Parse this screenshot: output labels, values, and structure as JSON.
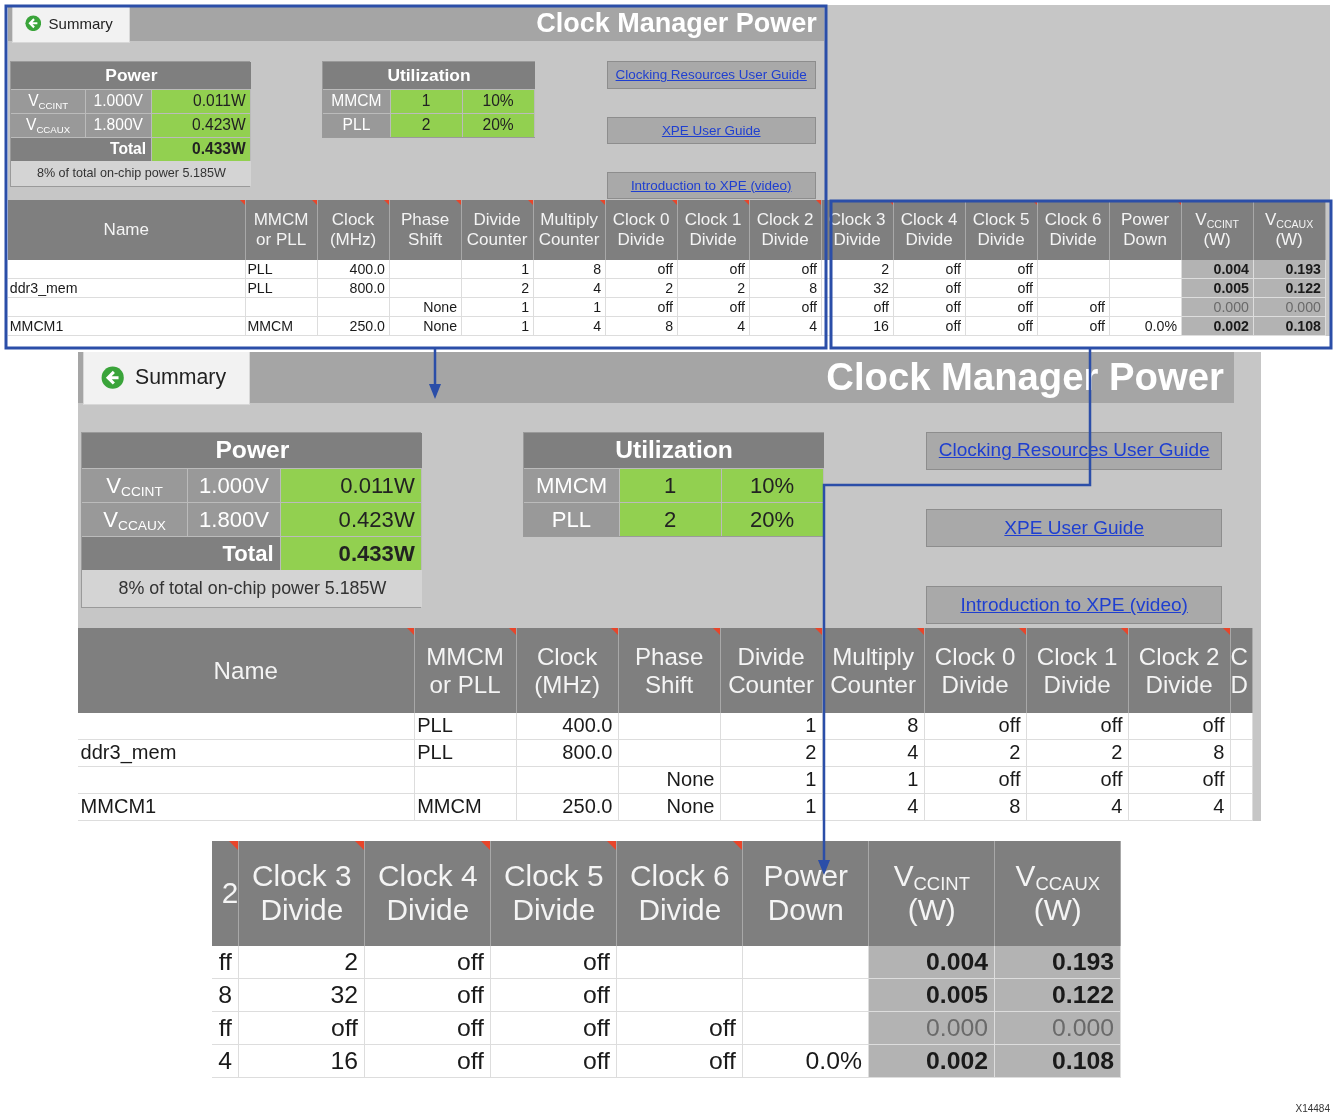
{
  "overview": {
    "summary_button": "Summary",
    "title": "Clock Manager Power",
    "power": {
      "heading": "Power",
      "rows": [
        {
          "label": "V$_{CCINT}$",
          "voltage": "1.000V",
          "watts": "0.011W"
        },
        {
          "label": "V$_{CCAUX}$",
          "voltage": "1.800V",
          "watts": "0.423W"
        }
      ],
      "total_label": "Total",
      "total": "0.433W",
      "note": "8% of total on-chip power 5.185W"
    },
    "utilization": {
      "heading": "Utilization",
      "rows": [
        {
          "label": "MMCM",
          "count": "1",
          "percent": "10%"
        },
        {
          "label": "PLL",
          "count": "2",
          "percent": "20%"
        }
      ]
    },
    "links": [
      "Clocking Resources User Guide",
      "XPE User Guide",
      "Introduction to XPE (video)"
    ],
    "table": {
      "columns": [
        {
          "kind": "name",
          "header": [
            "Name"
          ],
          "note": true
        },
        {
          "kind": "text",
          "header": [
            "MMCM",
            "or PLL"
          ],
          "note": true
        },
        {
          "kind": "number",
          "header": [
            "Clock",
            "(MHz)"
          ],
          "note": true
        },
        {
          "kind": "number",
          "header": [
            "Phase",
            "Shift"
          ],
          "note": true
        },
        {
          "kind": "number",
          "header": [
            "Divide",
            "Counter"
          ],
          "note": true
        },
        {
          "kind": "number",
          "header": [
            "Multiply",
            "Counter"
          ],
          "note": true
        },
        {
          "kind": "number",
          "header": [
            "Clock 0",
            "Divide"
          ],
          "note": true
        },
        {
          "kind": "number",
          "header": [
            "Clock 1",
            "Divide"
          ],
          "note": true
        },
        {
          "kind": "number",
          "header": [
            "Clock 2",
            "Divide"
          ],
          "note": true
        },
        {
          "kind": "number",
          "header": [
            "Clock 3",
            "Divide"
          ],
          "note": true
        },
        {
          "kind": "number",
          "header": [
            "Clock 4",
            "Divide"
          ],
          "note": false
        },
        {
          "kind": "number",
          "header": [
            "Clock 5",
            "Divide"
          ],
          "note": true
        },
        {
          "kind": "number",
          "header": [
            "Clock 6",
            "Divide"
          ],
          "note": false
        },
        {
          "kind": "number",
          "header": [
            "Power",
            "Down"
          ],
          "note": true
        },
        {
          "kind": "power",
          "header": [
            "V$_{CCINT}$",
            "(W)"
          ],
          "note": false
        },
        {
          "kind": "power",
          "header": [
            "V$_{CCAUX}$",
            "(W)"
          ],
          "note": false
        }
      ],
      "rows": [
        {
          "dimmed": false,
          "cells": [
            "",
            "PLL",
            "400.0",
            "",
            "1",
            "8",
            "off",
            "off",
            "off",
            "2",
            "off",
            "off",
            "",
            "",
            "0.004",
            "0.193"
          ]
        },
        {
          "dimmed": false,
          "cells": [
            "ddr3_mem",
            "PLL",
            "800.0",
            "",
            "2",
            "4",
            "2",
            "2",
            "8",
            "32",
            "off",
            "off",
            "",
            "",
            "0.005",
            "0.122"
          ]
        },
        {
          "dimmed": true,
          "cells": [
            "",
            "",
            "",
            "None",
            "1",
            "1",
            "off",
            "off",
            "off",
            "off",
            "off",
            "off",
            "off",
            "",
            "0.000",
            "0.000"
          ]
        },
        {
          "dimmed": false,
          "cells": [
            "MMCM1",
            "MMCM",
            "250.0",
            "None",
            "1",
            "4",
            "8",
            "4",
            "4",
            "16",
            "off",
            "off",
            "off",
            "0.0%",
            "0.002",
            "0.108"
          ]
        }
      ]
    }
  },
  "detail_left": {
    "summary_button": "Summary",
    "title": "Clock Manager Power",
    "power": {
      "heading": "Power",
      "rows": [
        {
          "label": "V$_{CCINT}$",
          "voltage": "1.000V",
          "watts": "0.011W"
        },
        {
          "label": "V$_{CCAUX}$",
          "voltage": "1.800V",
          "watts": "0.423W"
        }
      ],
      "total_label": "Total",
      "total": "0.433W",
      "note": "8% of total on-chip power 5.185W"
    },
    "utilization": {
      "heading": "Utilization",
      "rows": [
        {
          "label": "MMCM",
          "count": "1",
          "percent": "10%"
        },
        {
          "label": "PLL",
          "count": "2",
          "percent": "20%"
        }
      ]
    },
    "links": [
      "Clocking Resources User Guide",
      "XPE User Guide",
      "Introduction to XPE (video)"
    ],
    "table": {
      "columns": [
        {
          "kind": "name",
          "header": [
            "Name"
          ],
          "note": true
        },
        {
          "kind": "text",
          "header": [
            "MMCM",
            "or PLL"
          ],
          "note": true
        },
        {
          "kind": "number",
          "header": [
            "Clock",
            "(MHz)"
          ],
          "note": true
        },
        {
          "kind": "number",
          "header": [
            "Phase",
            "Shift"
          ],
          "note": true
        },
        {
          "kind": "number",
          "header": [
            "Divide",
            "Counter"
          ],
          "note": true
        },
        {
          "kind": "number",
          "header": [
            "Multiply",
            "Counter"
          ],
          "note": true
        },
        {
          "kind": "number",
          "header": [
            "Clock 0",
            "Divide"
          ],
          "note": true
        },
        {
          "kind": "number",
          "header": [
            "Clock 1",
            "Divide"
          ],
          "note": true
        },
        {
          "kind": "number",
          "header": [
            "Clock 2",
            "Divide"
          ],
          "note": true
        },
        {
          "kind": "cut_end",
          "header": [
            "C",
            "D"
          ],
          "note": false
        }
      ],
      "rows": [
        {
          "cells": [
            "",
            "PLL",
            "400.0",
            "",
            "1",
            "8",
            "off",
            "off",
            "off",
            ""
          ]
        },
        {
          "cells": [
            "ddr3_mem",
            "PLL",
            "800.0",
            "",
            "2",
            "4",
            "2",
            "2",
            "8",
            ""
          ]
        },
        {
          "cells": [
            "",
            "",
            "",
            "None",
            "1",
            "1",
            "off",
            "off",
            "off",
            ""
          ]
        },
        {
          "cells": [
            "MMCM1",
            "MMCM",
            "250.0",
            "None",
            "1",
            "4",
            "8",
            "4",
            "4",
            ""
          ]
        }
      ]
    }
  },
  "detail_right": {
    "table": {
      "columns": [
        {
          "kind": "cut_start",
          "header": [
            "2"
          ],
          "note": true
        },
        {
          "kind": "number",
          "header": [
            "Clock 3",
            "Divide"
          ],
          "note": true
        },
        {
          "kind": "number",
          "header": [
            "Clock 4",
            "Divide"
          ],
          "note": true
        },
        {
          "kind": "number",
          "header": [
            "Clock 5",
            "Divide"
          ],
          "note": true
        },
        {
          "kind": "number",
          "header": [
            "Clock 6",
            "Divide"
          ],
          "note": true
        },
        {
          "kind": "number",
          "header": [
            "Power",
            "Down"
          ],
          "note": false
        },
        {
          "kind": "power",
          "header": [
            "V$_{CCINT}$",
            "(W)"
          ],
          "note": false
        },
        {
          "kind": "power",
          "header": [
            "V$_{CCAUX}$",
            "(W)"
          ],
          "note": false
        }
      ],
      "rows": [
        {
          "dimmed": false,
          "cells": [
            "ff",
            "2",
            "off",
            "off",
            "",
            "",
            "0.004",
            "0.193"
          ]
        },
        {
          "dimmed": false,
          "cells": [
            "8",
            "32",
            "off",
            "off",
            "",
            "",
            "0.005",
            "0.122"
          ]
        },
        {
          "dimmed": true,
          "cells": [
            "ff",
            "off",
            "off",
            "off",
            "off",
            "",
            "0.000",
            "0.000"
          ]
        },
        {
          "dimmed": false,
          "cells": [
            "4",
            "16",
            "off",
            "off",
            "off",
            "0.0%",
            "0.002",
            "0.108"
          ]
        }
      ]
    }
  },
  "figure_id": "X14484"
}
